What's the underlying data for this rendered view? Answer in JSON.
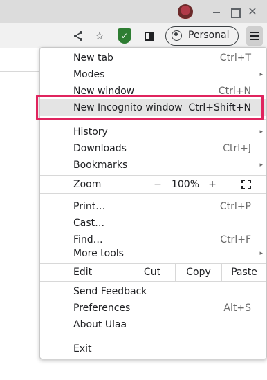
{
  "window": {
    "profile_label": "Personal"
  },
  "icons": {
    "share": "share-icon",
    "star": "bookmark-star-icon",
    "shield": "ulaa-shield-icon",
    "side_panel": "side-panel-icon",
    "profile": "profile-icon",
    "menu": "hamburger-menu-icon",
    "minimize": "minimize-icon",
    "maximize": "maximize-icon",
    "close": "close-icon",
    "submenu_arrow": "▸",
    "fullscreen": "fullscreen-icon"
  },
  "colors": {
    "highlight_border": "#e0245e",
    "shield": "#2e7d32"
  },
  "menu": {
    "new_tab": {
      "label": "New tab",
      "shortcut": "Ctrl+T"
    },
    "modes": {
      "label": "Modes"
    },
    "new_window": {
      "label": "New window",
      "shortcut": "Ctrl+N"
    },
    "new_incognito": {
      "label": "New Incognito window",
      "shortcut": "Ctrl+Shift+N"
    },
    "history": {
      "label": "History"
    },
    "downloads": {
      "label": "Downloads",
      "shortcut": "Ctrl+J"
    },
    "bookmarks": {
      "label": "Bookmarks"
    },
    "zoom": {
      "label": "Zoom",
      "minus": "−",
      "value": "100%",
      "plus": "+"
    },
    "print": {
      "label": "Print…",
      "shortcut": "Ctrl+P"
    },
    "cast": {
      "label": "Cast…"
    },
    "find": {
      "label": "Find…",
      "shortcut": "Ctrl+F"
    },
    "more_tools": {
      "label": "More tools"
    },
    "edit": {
      "label": "Edit",
      "cut": "Cut",
      "copy": "Copy",
      "paste": "Paste"
    },
    "send_feedback": {
      "label": "Send Feedback"
    },
    "preferences": {
      "label": "Preferences",
      "shortcut": "Alt+S"
    },
    "about": {
      "label": "About Ulaa"
    },
    "exit": {
      "label": "Exit"
    }
  }
}
